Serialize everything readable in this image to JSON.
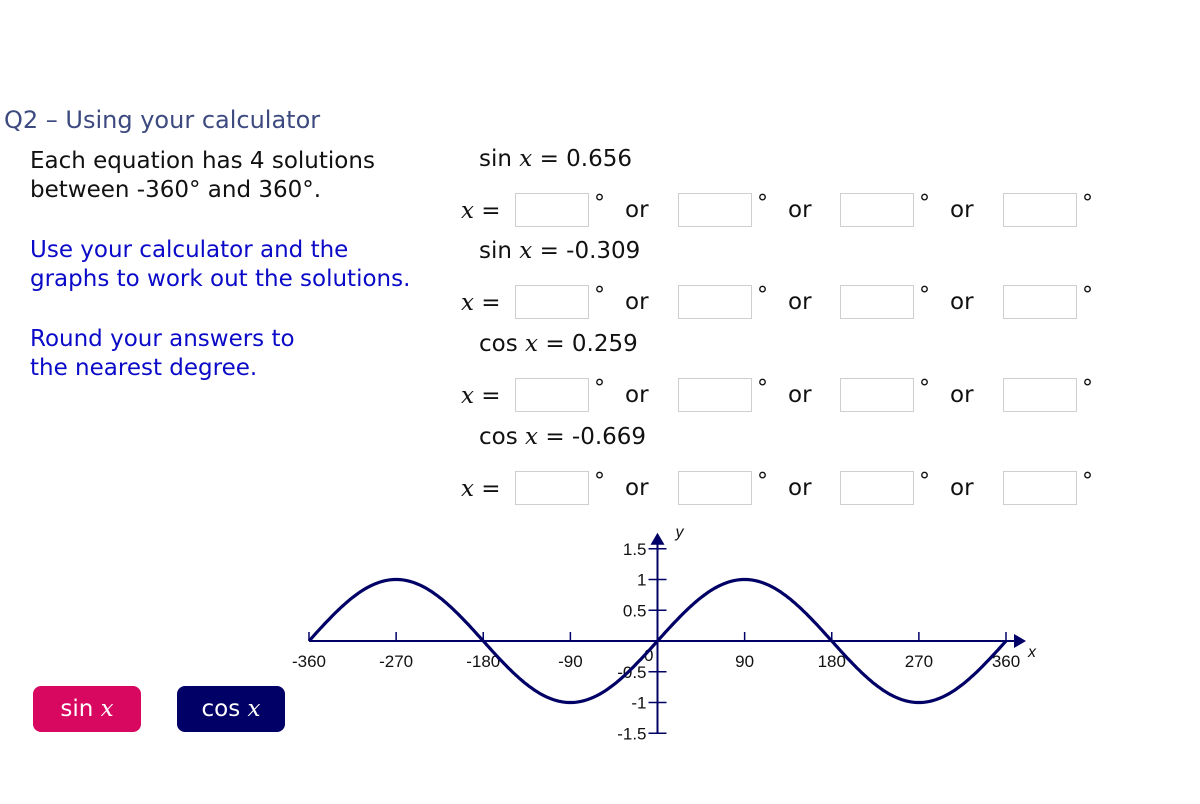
{
  "question": {
    "title": "Q2 – Using your calculator",
    "intro_line1": "Each equation has 4 solutions",
    "intro_line2": "between -360° and 360°.",
    "instruction1_line1": "Use your calculator and the",
    "instruction1_line2": "graphs to work out the solutions.",
    "instruction2_line1": "Round your answers to",
    "instruction2_line2": "the nearest degree."
  },
  "equations": [
    {
      "func": "sin",
      "var": "x",
      "equals": "=",
      "value": "0.656",
      "x_label": "x",
      "x_equals": "=",
      "answers": [
        "",
        "",
        "",
        ""
      ],
      "degree": "°",
      "or": "or"
    },
    {
      "func": "sin",
      "var": "x",
      "equals": "=",
      "value": "-0.309",
      "x_label": "x",
      "x_equals": "=",
      "answers": [
        "",
        "",
        "",
        ""
      ],
      "degree": "°",
      "or": "or"
    },
    {
      "func": "cos",
      "var": "x",
      "equals": "=",
      "value": "0.259",
      "x_label": "x",
      "x_equals": "=",
      "answers": [
        "",
        "",
        "",
        ""
      ],
      "degree": "°",
      "or": "or"
    },
    {
      "func": "cos",
      "var": "x",
      "equals": "=",
      "value": "-0.669",
      "x_label": "x",
      "x_equals": "=",
      "answers": [
        "",
        "",
        "",
        ""
      ],
      "degree": "°",
      "or": "or"
    }
  ],
  "buttons": {
    "sin": {
      "func": "sin",
      "var": "x",
      "color": "#d8075f",
      "active": true
    },
    "cos": {
      "func": "cos",
      "var": "x",
      "color": "#000066",
      "active": false
    }
  },
  "chart_data": {
    "type": "line",
    "title": "",
    "xlabel": "x",
    "ylabel": "y",
    "xlim": [
      -360,
      360
    ],
    "ylim": [
      -1.5,
      1.5
    ],
    "grid": false,
    "x_ticks": [
      -360,
      -270,
      -180,
      -90,
      0,
      90,
      180,
      270,
      360
    ],
    "x_tick_labels": [
      "-360",
      "-270",
      "-180",
      "-90",
      "0",
      "90",
      "180",
      "270",
      "360"
    ],
    "y_ticks": [
      1.5,
      1,
      0.5,
      -0.5,
      -1,
      -1.5
    ],
    "y_tick_labels": [
      "1.5",
      "1",
      "0.5",
      "-0.5",
      "-1",
      "-1.5"
    ],
    "origin_label": "0",
    "series": [
      {
        "name": "sin x",
        "function": "sin",
        "color": "#000066",
        "x": [
          -360,
          -315,
          -270,
          -225,
          -180,
          -135,
          -90,
          -45,
          0,
          45,
          90,
          135,
          180,
          225,
          270,
          315,
          360
        ],
        "values": [
          0,
          0.707,
          1,
          0.707,
          0,
          -0.707,
          -1,
          -0.707,
          0,
          0.707,
          1,
          0.707,
          0,
          -0.707,
          -1,
          -0.707,
          0
        ]
      }
    ],
    "axis_color": "#000066"
  }
}
